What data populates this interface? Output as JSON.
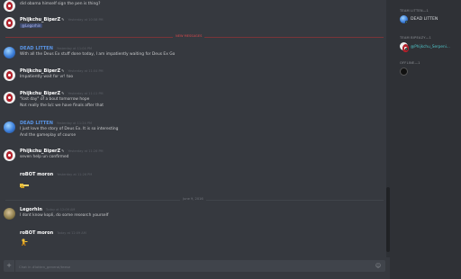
{
  "messages": [
    {
      "user": "",
      "ts": "",
      "lines": [
        "did obama himself sign the pen is thing?"
      ]
    },
    {
      "user": "Phijkchu_BiperZ",
      "ts": "Yesterday at 10:58 PM",
      "mention": "@Legorhin"
    },
    {
      "user": "DEAD LITTEN",
      "ts": "Yesterday at 11:04 PM",
      "lines": [
        "With all the Deus Ex stuff done today, I am impatiently waiting for Deus Ex Go"
      ]
    },
    {
      "user": "Phijkchu_BiperZ",
      "ts": "Yesterday at 11:04 PM",
      "lines": [
        "Impatiently wait for vr! too"
      ]
    },
    {
      "user": "Phijkchu_BiperZ",
      "ts": "Yesterday at 11:11 PM",
      "lines": [
        "\"lost day\" of a bout tomorrow hope",
        "Not really the b/c we have finals after that"
      ]
    },
    {
      "user": "DEAD LITTEN",
      "ts": "Yesterday at 11:24 PM",
      "lines": [
        "I just love the story of Deus Ex. It is so interesting",
        "And the gameplay of course"
      ]
    },
    {
      "user": "Phijkchu_BiperZ",
      "ts": "Yesterday at 11:26 PM",
      "lines": [
        "seven help un confirmed"
      ]
    },
    {
      "user": "roBOT moron",
      "ts": "Yesterday at 11:26 PM",
      "emote": "pointing-hand"
    },
    {
      "user": "Legorhin",
      "ts": "Today at 12:09 AM",
      "lines": [
        "I dont know kopli, do some research yourself"
      ]
    },
    {
      "user": "roBOT moron",
      "ts": "Today at 12:09 AM",
      "emote": "dancing-figure"
    }
  ],
  "dividers": {
    "new_messages": "NEW MESSAGES",
    "date": "June 9, 2016"
  },
  "input": {
    "placeholder": "Chat in #lotten_general/teese"
  },
  "members": {
    "categories": [
      {
        "label": "TEAM LITTEN—1"
      },
      {
        "label": "TEAM BIPEAZY—1"
      },
      {
        "label": "OFFLINE—1"
      }
    ],
    "team_litten": [
      {
        "name": "DEAD LITTEN",
        "color": "#d9dcdf"
      }
    ],
    "team_bipeazy": [
      {
        "name": "@Phijkchu_Serpeni...",
        "color": "#4fc3c7"
      }
    ],
    "offline": [
      {
        "name": ""
      }
    ]
  },
  "colors": {
    "dead_litten": "#5a95e6",
    "biper": "#ffffff",
    "robot": "#ffffff",
    "legorhin": "#ffffff",
    "new_divider": "#d9484c"
  }
}
